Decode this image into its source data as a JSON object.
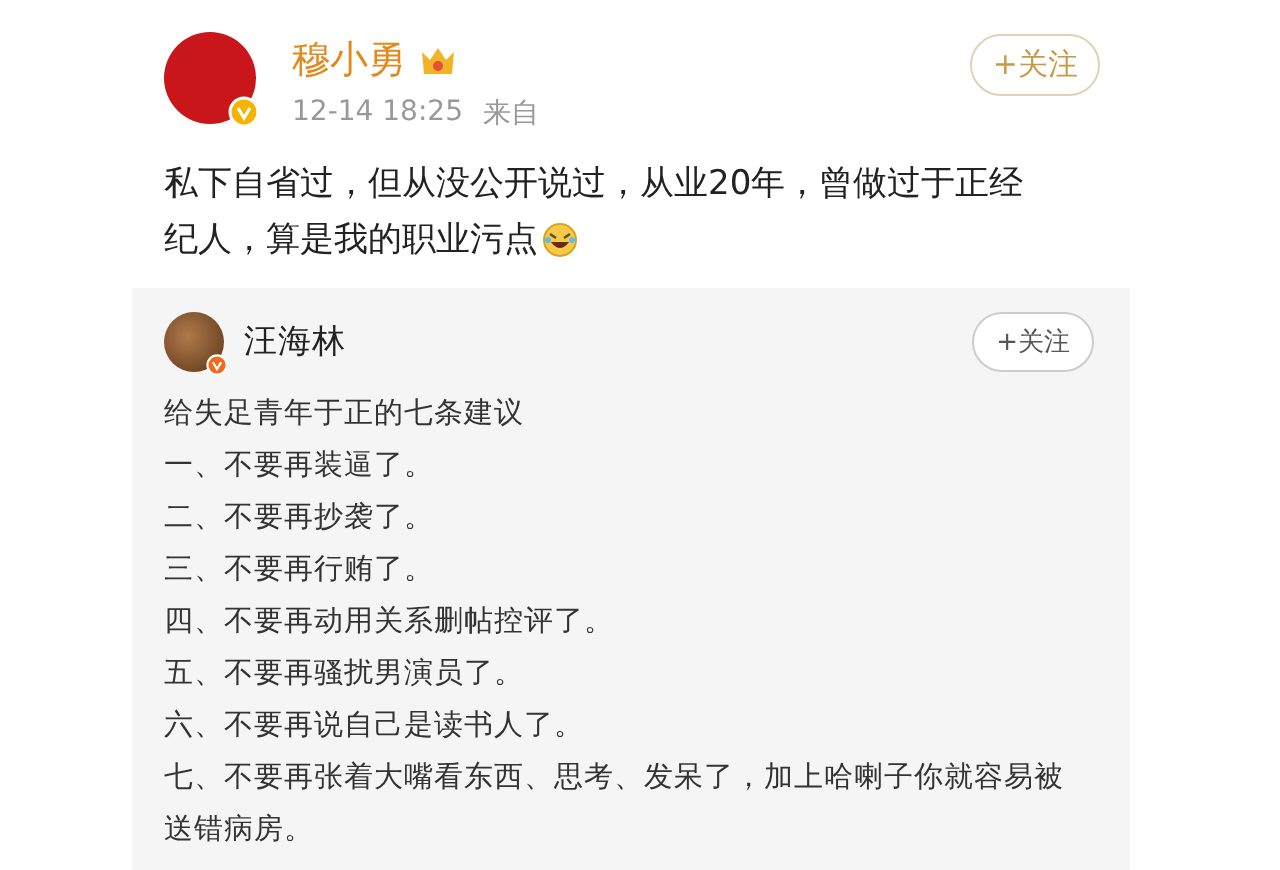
{
  "post": {
    "author": "穆小勇",
    "time": "12-14 18:25",
    "source": "来自",
    "follow_button": "+关注",
    "text_lines": [
      "私下自省过，但从没公开说过，从业20年，曾做过于正经",
      "纪人，算是我的职业污点"
    ]
  },
  "quote": {
    "author": "汪海林",
    "follow_button": "+关注",
    "lines": [
      "给失足青年于正的七条建议",
      "一、不要再装逼了。",
      "二、不要再抄袭了。",
      "三、不要再行贿了。",
      "四、不要再动用关系删帖控评了。",
      "五、不要再骚扰男演员了。",
      "六、不要再说自己是读书人了。",
      "七、不要再张着大嘴看东西、思考、发呆了，加上哈喇子你就容易被送错病房。"
    ]
  }
}
